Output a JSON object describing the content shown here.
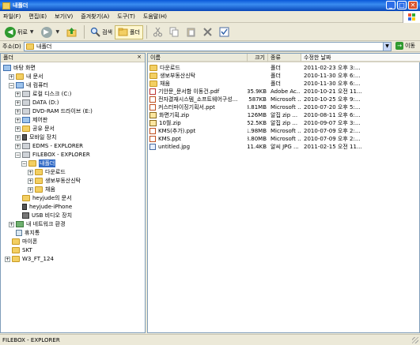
{
  "window": {
    "title": "내폴더",
    "buttons": [
      "_",
      "□",
      "✕"
    ]
  },
  "menu": [
    "파일(F)",
    "편집(E)",
    "보기(V)",
    "즐겨찾기(A)",
    "도구(T)",
    "도움말(H)"
  ],
  "toolbar": {
    "back_label": "뒤로",
    "search_label": "검색",
    "folders_label": "폴더"
  },
  "address": {
    "label": "주소(D)",
    "value": "내폴더",
    "go_label": "이동"
  },
  "folder_pane": {
    "header": "폴더",
    "close": "×",
    "tree": [
      {
        "label": "바탕 화면",
        "icon": "desktop-icon",
        "exp": ""
      },
      {
        "label": "내 문서",
        "icon": "folder-icon",
        "exp": "+"
      },
      {
        "label": "내 컴퓨터",
        "icon": "computer-icon",
        "exp": "−"
      },
      {
        "label": "로컬 디스크 (C:)",
        "icon": "drive-icon",
        "exp": "+"
      },
      {
        "label": "DATA (D:)",
        "icon": "drive-icon",
        "exp": "+"
      },
      {
        "label": "DVD-RAM 드라이브 (E:)",
        "icon": "dvd-drive-icon",
        "exp": "+"
      },
      {
        "label": "제어판",
        "icon": "control-panel-icon",
        "exp": "+"
      },
      {
        "label": "공유 문서",
        "icon": "folder-icon",
        "exp": "+"
      },
      {
        "label": "모바일 장치",
        "icon": "mobile-device-icon",
        "exp": "+"
      },
      {
        "label": "EDMS - EXPLORER",
        "icon": "network-drive-icon",
        "exp": "+"
      },
      {
        "label": "FILEBOX - EXPLORER",
        "icon": "network-drive-icon",
        "exp": "−"
      },
      {
        "label": "내폴더",
        "icon": "folder-open-icon",
        "exp": "−"
      },
      {
        "label": "다운로드",
        "icon": "folder-icon",
        "exp": "+"
      },
      {
        "label": "생보부동산신탁",
        "icon": "folder-icon",
        "exp": "+"
      },
      {
        "label": "채움",
        "icon": "folder-icon",
        "exp": "+"
      },
      {
        "label": "heyjude의 문서",
        "icon": "folder-icon",
        "exp": ""
      },
      {
        "label": "heyjude-iPhone",
        "icon": "phone-icon",
        "exp": ""
      },
      {
        "label": "USB 비디오 장치",
        "icon": "camera-icon",
        "exp": ""
      },
      {
        "label": "내 네트워크 환경",
        "icon": "network-icon",
        "exp": "+"
      },
      {
        "label": "휴지통",
        "icon": "recycle-bin-icon",
        "exp": ""
      },
      {
        "label": "마이폰",
        "icon": "folder-icon",
        "exp": ""
      },
      {
        "label": "SKT",
        "icon": "folder-icon",
        "exp": ""
      },
      {
        "label": "W3_FT_124",
        "icon": "folder-icon",
        "exp": "+"
      }
    ]
  },
  "file_list": {
    "columns": [
      "이름",
      "크기",
      "종류",
      "수정한 날짜"
    ],
    "rows": [
      {
        "name": "다운로드",
        "size": "",
        "type": "폴더",
        "date": "2011-02-23 오후 3:...",
        "icon": "folder-icon"
      },
      {
        "name": "생보부동산신탁",
        "size": "",
        "type": "폴더",
        "date": "2010-11-30 오후 6:...",
        "icon": "folder-icon"
      },
      {
        "name": "채움",
        "size": "",
        "type": "폴더",
        "date": "2010-11-30 오후 6:...",
        "icon": "folder-icon"
      },
      {
        "name": "기안문_문서함 이동건.pdf",
        "size": "35.9KB",
        "type": "Adobe Ac...",
        "date": "2010-10-21 오전 11...",
        "icon": "pdf-icon"
      },
      {
        "name": "전자결재시스템_소프트웨어구성...",
        "size": "587KB",
        "type": "Microsoft ...",
        "date": "2010-10-25 오후 9:...",
        "icon": "ppt-icon"
      },
      {
        "name": "커스터마이징기획서.ppt",
        "size": "3.81MB",
        "type": "Microsoft ...",
        "date": "2010-07-20 오후 5:...",
        "icon": "ppt-icon"
      },
      {
        "name": "화면기획.zip",
        "size": "126MB",
        "type": "알집 zip ...",
        "date": "2010-08-11 오후 6:...",
        "icon": "zip-icon"
      },
      {
        "name": "10월.zip",
        "size": "52.5KB",
        "type": "알집 zip ...",
        "date": "2010-09-07 오후 3:...",
        "icon": "zip-icon"
      },
      {
        "name": "KMS(추가).ppt",
        "size": "1.98MB",
        "type": "Microsoft ...",
        "date": "2010-07-09 오후 2:...",
        "icon": "ppt-icon"
      },
      {
        "name": "KMS.ppt",
        "size": "8.80MB",
        "type": "Microsoft ...",
        "date": "2010-07-09 오후 2:...",
        "icon": "ppt-icon"
      },
      {
        "name": "untitled.jpg",
        "size": "11.4KB",
        "type": "알씨 JPG ...",
        "date": "2011-02-15 오전 11...",
        "icon": "jpg-icon"
      }
    ]
  },
  "status": {
    "text": "FILEBOX - EXPLORER"
  }
}
